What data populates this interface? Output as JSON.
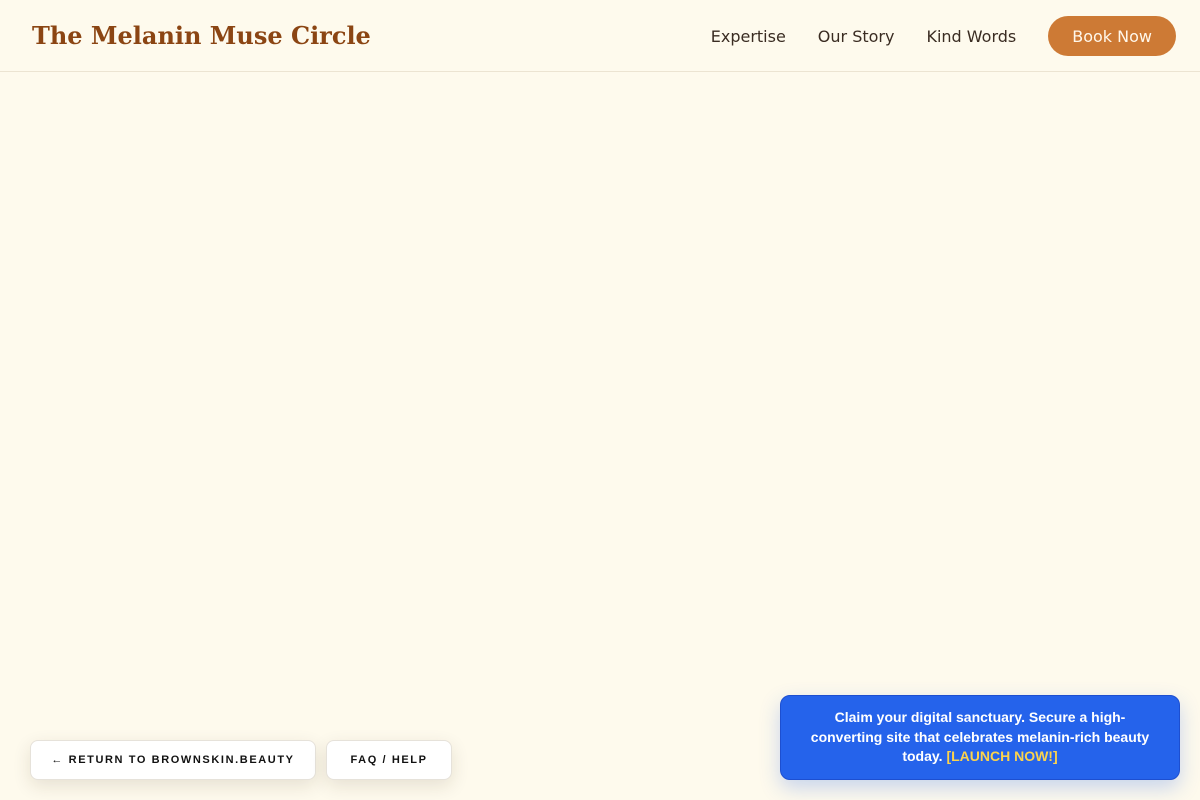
{
  "header": {
    "brand": "The Melanin Muse Circle",
    "nav": [
      {
        "label": "Expertise"
      },
      {
        "label": "Our Story"
      },
      {
        "label": "Kind Words"
      }
    ],
    "cta_label": "Book Now"
  },
  "footer_buttons": {
    "return_label": "← RETURN TO BROWNSKIN.BEAUTY",
    "faq_label": "FAQ / HELP"
  },
  "promo": {
    "message": "Claim your digital sanctuary. Secure a high-converting site that celebrates melanin-rich beauty today.",
    "link_label": "[LAUNCH NOW!]"
  },
  "colors": {
    "background": "#fefaed",
    "brand": "#8b4513",
    "accent": "#cd7a35",
    "promo_bg": "#2563eb",
    "promo_link": "#fcd34d"
  }
}
